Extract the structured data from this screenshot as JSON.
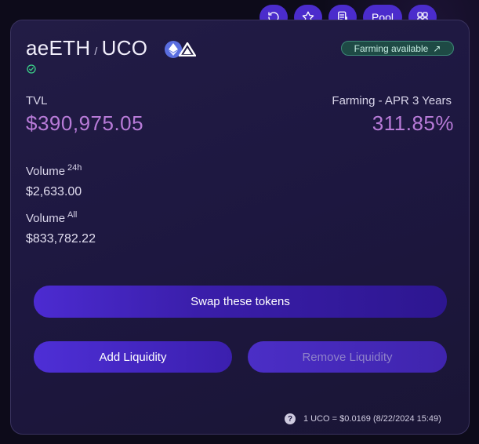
{
  "pair": {
    "token_a": "aeETH",
    "separator": "/",
    "token_b": "UCO"
  },
  "badge": {
    "farming": "Farming available",
    "arrow": "↗"
  },
  "toolbar": {
    "refresh_icon": "refresh-icon",
    "favorite_icon": "star-icon",
    "explorer_icon": "receipt-icon",
    "pool_label": "Pool",
    "apps_icon": "grid-icon"
  },
  "tvl": {
    "label": "TVL",
    "value": "$390,975.05"
  },
  "farming_apr": {
    "label": "Farming - APR 3 Years",
    "value": "311.85%"
  },
  "volume_24h": {
    "label": "Volume",
    "suffix": "24h",
    "value": "$2,633.00"
  },
  "volume_all": {
    "label": "Volume",
    "suffix": "All",
    "value": "$833,782.22"
  },
  "actions": {
    "swap": "Swap these tokens",
    "add": "Add Liquidity",
    "remove": "Remove Liquidity"
  },
  "footer": {
    "help_glyph": "?",
    "rate": "1 UCO = $0.0169 (8/22/2024 15:49)"
  },
  "colors": {
    "accent": "#4b2ccc",
    "highlight": "#b87bd8",
    "badge_bg": "#1e4a45",
    "card_bg": "#221c45"
  }
}
